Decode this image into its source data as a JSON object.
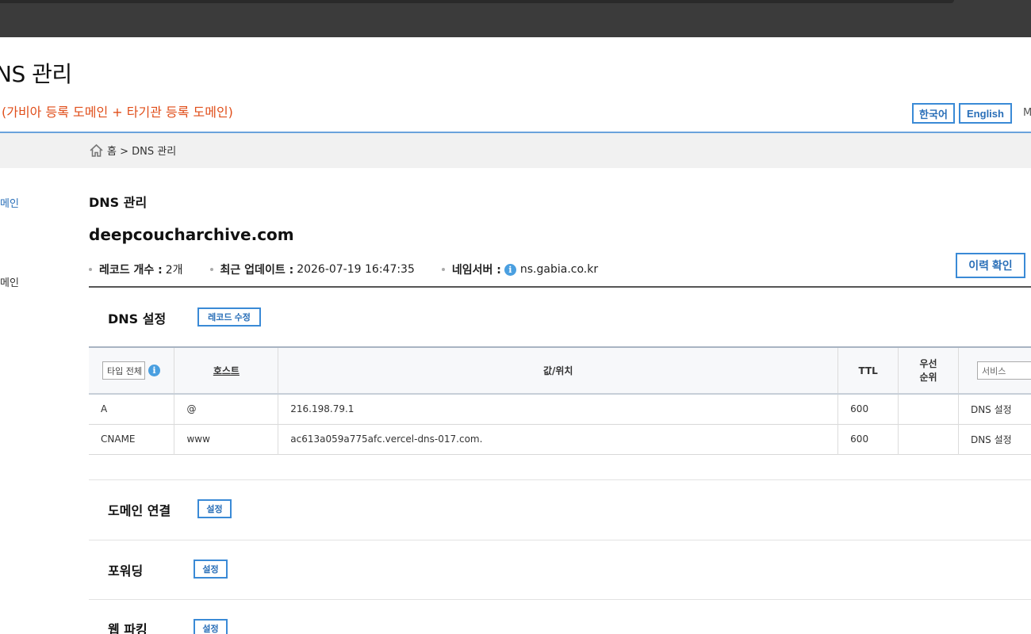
{
  "header": {
    "page_title": "NS 관리",
    "subtitle": "(가비아 등록 도메인 + 타기관 등록 도메인)",
    "lang_korean": "한국어",
    "lang_english": "English",
    "lang_more": "M"
  },
  "breadcrumb": {
    "icon": "home-icon",
    "text": "홈 > DNS 관리"
  },
  "sidebar": {
    "items": [
      {
        "label": "메인"
      },
      {
        "label": "메인"
      }
    ]
  },
  "main": {
    "section_title": "DNS 관리",
    "domain": "deepcoucharchive.com",
    "meta": {
      "record_count_label": "레코드 개수 :",
      "record_count_value": "2개",
      "last_update_label": "최근 업데이트 :",
      "last_update_value": "2026-07-19 16:47:35",
      "nameserver_label": "네임서버 :",
      "nameserver_value": "ns.gabia.co.kr"
    },
    "history_button": "이력 확인"
  },
  "dns_settings": {
    "title": "DNS 설정",
    "edit_button": "레코드 수정",
    "columns": {
      "type_filter": "타입 전체",
      "host": "호스트",
      "value": "값/위치",
      "ttl": "TTL",
      "priority_line1": "우선",
      "priority_line2": "순위",
      "service_filter": "서비스"
    },
    "rows": [
      {
        "type": "A",
        "host": "@",
        "value": "216.198.79.1",
        "ttl": "600",
        "priority": "",
        "service": "DNS 설정"
      },
      {
        "type": "CNAME",
        "host": "www",
        "value": "ac613a059a775afc.vercel-dns-017.com.",
        "ttl": "600",
        "priority": "",
        "service": "DNS 설정"
      }
    ]
  },
  "sections": {
    "domain_link": {
      "title": "도메인 연결",
      "button": "설정"
    },
    "forwarding": {
      "title": "포워딩",
      "button": "설정"
    },
    "web_parking": {
      "title": "웹 파킹",
      "button": "설정"
    }
  },
  "colors": {
    "accent": "#3a8ad6",
    "subtitle_orange": "#e04e1a",
    "topbar": "#3b3b3b"
  }
}
